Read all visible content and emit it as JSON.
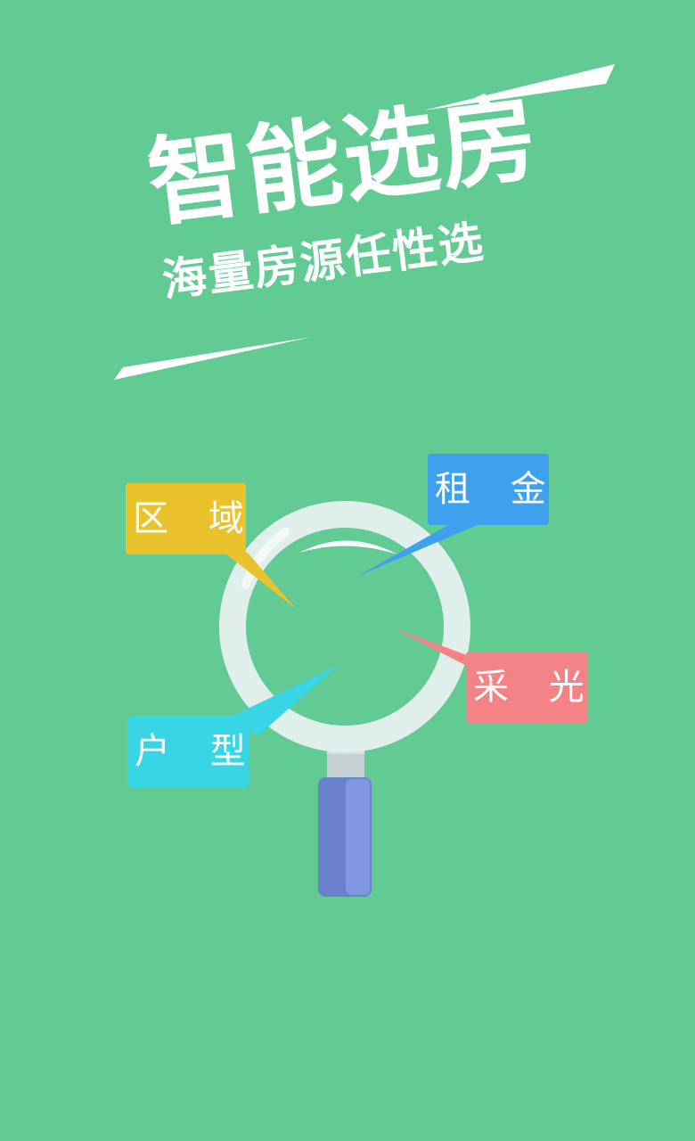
{
  "headline": "智能选房",
  "subtitle": "海量房源任性选",
  "tags": [
    {
      "label": "区 域",
      "color": "#E9C32B"
    },
    {
      "label": "租 金",
      "color": "#3EA1EE"
    },
    {
      "label": "采 光",
      "color": "#F38384"
    },
    {
      "label": "户 型",
      "color": "#37D5E5"
    }
  ],
  "colors": {
    "background": "#61CB93",
    "text": "#FFFFFF",
    "lens_ring": "#E1EFEC",
    "handle": "#6A82CC"
  },
  "icons": {
    "magnifier": "magnifying-glass-icon"
  }
}
